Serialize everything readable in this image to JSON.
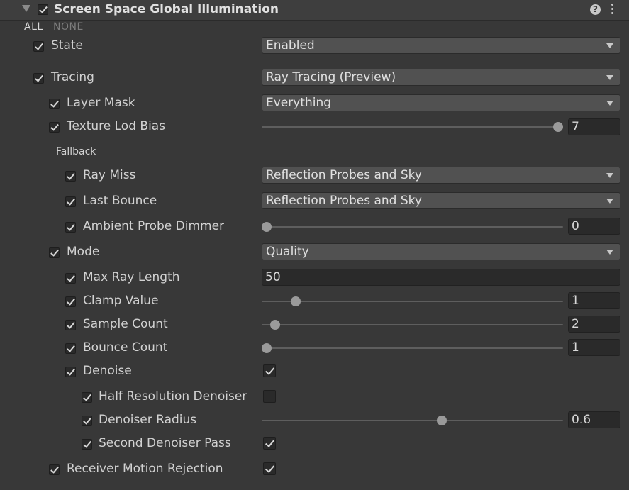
{
  "header": {
    "title": "Screen Space Global Illumination",
    "help_icon": "help-icon",
    "menu_icon": "kebab-menu-icon"
  },
  "toggles": {
    "all_label": "ALL",
    "none_label": "NONE"
  },
  "rows": {
    "state": {
      "label": "State",
      "value": "Enabled"
    },
    "tracing": {
      "label": "Tracing",
      "value": "Ray Tracing (Preview)"
    },
    "layer_mask": {
      "label": "Layer Mask",
      "value": "Everything"
    },
    "texture_lod_bias": {
      "label": "Texture Lod Bias",
      "value": "7",
      "slider_fraction": 1.0
    },
    "fallback_header": "Fallback",
    "ray_miss": {
      "label": "Ray Miss",
      "value": "Reflection Probes and Sky"
    },
    "last_bounce": {
      "label": "Last Bounce",
      "value": "Reflection Probes and Sky"
    },
    "ambient_probe_dimmer": {
      "label": "Ambient Probe Dimmer",
      "value": "0",
      "slider_fraction": 0.0
    },
    "mode": {
      "label": "Mode",
      "value": "Quality"
    },
    "max_ray_length": {
      "label": "Max Ray Length",
      "value": "50"
    },
    "clamp_value": {
      "label": "Clamp Value",
      "value": "1",
      "slider_fraction": 0.1
    },
    "sample_count": {
      "label": "Sample Count",
      "value": "2",
      "slider_fraction": 0.03
    },
    "bounce_count": {
      "label": "Bounce Count",
      "value": "1",
      "slider_fraction": 0.0
    },
    "denoise": {
      "label": "Denoise",
      "checked": true
    },
    "half_resolution_denoiser": {
      "label": "Half Resolution Denoiser",
      "checked": false
    },
    "denoiser_radius": {
      "label": "Denoiser Radius",
      "value": "0.6",
      "slider_fraction": 0.6
    },
    "second_denoiser_pass": {
      "label": "Second Denoiser Pass",
      "checked": true
    },
    "receiver_motion_rejection": {
      "label": "Receiver Motion Rejection",
      "checked": true
    }
  },
  "colors": {
    "background": "#383838",
    "header": "#3e3e3e",
    "dropdown": "#515151",
    "field": "#2a2a2a",
    "text": "#d2d2d2"
  }
}
